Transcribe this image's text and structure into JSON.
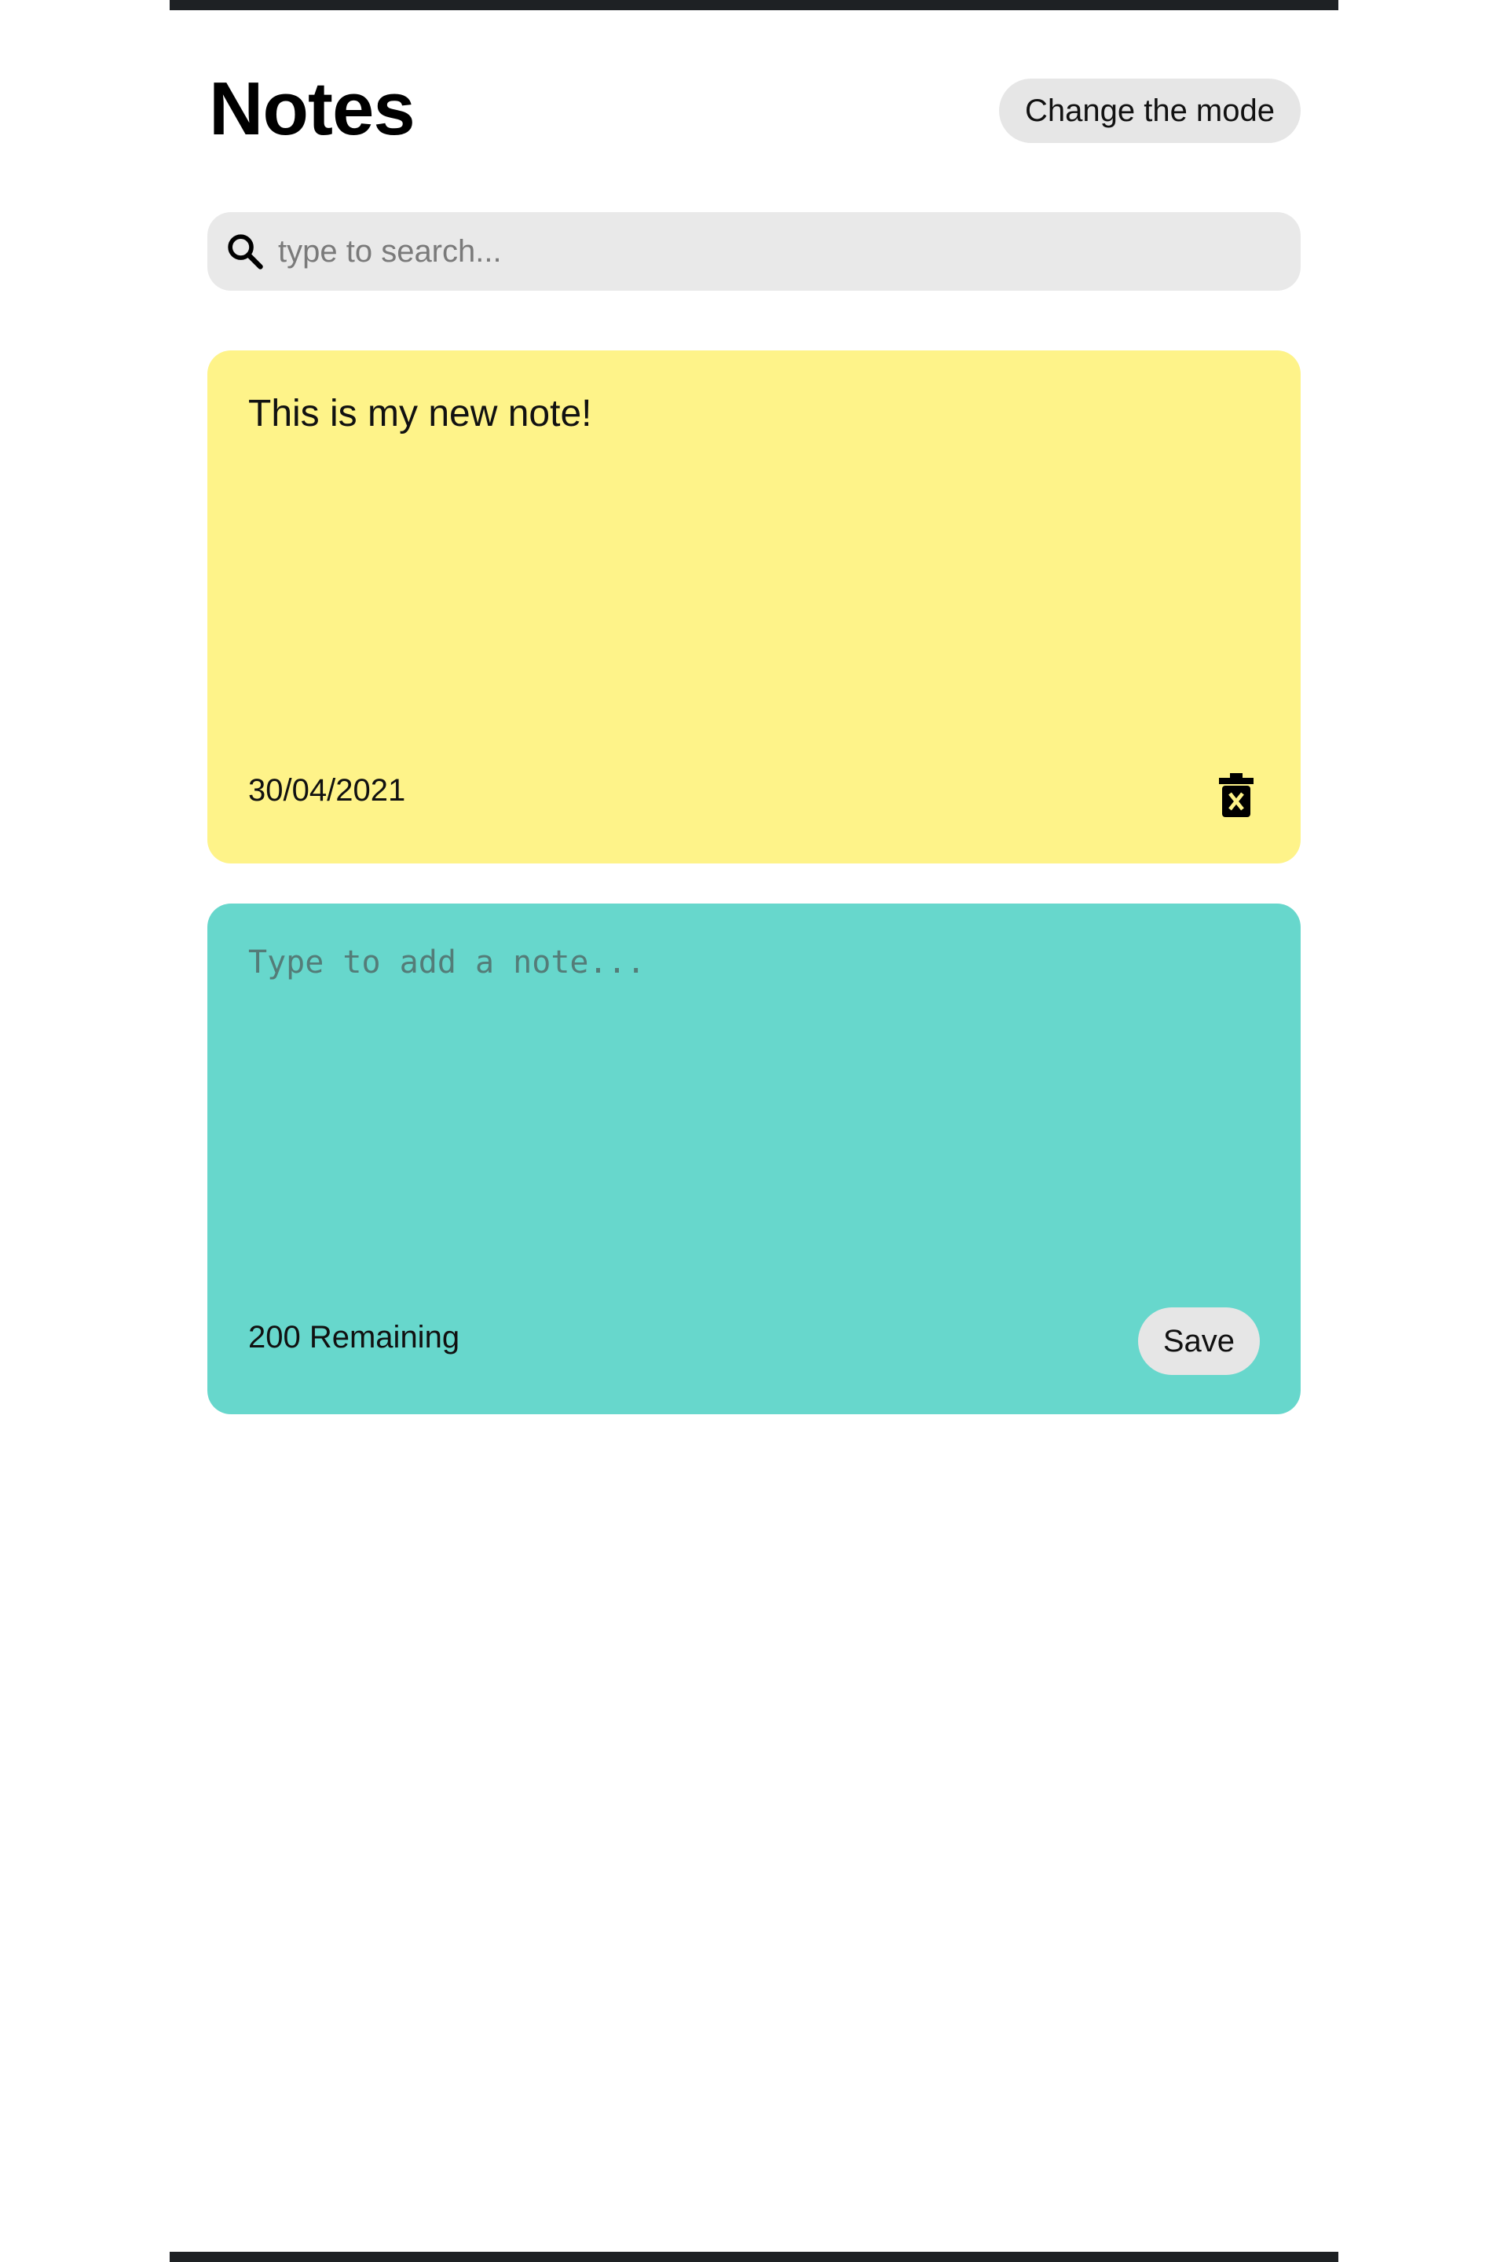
{
  "header": {
    "title": "Notes",
    "mode_button_label": "Change the mode"
  },
  "search": {
    "icon": "search-icon",
    "placeholder": "type to search..."
  },
  "notes": [
    {
      "text": "This is my new note!",
      "date": "30/04/2021",
      "delete_icon": "trash-icon",
      "color": "#fef389"
    }
  ],
  "add_note": {
    "placeholder": "Type to add a note...",
    "remaining": "200 Remaining",
    "save_label": "Save",
    "color": "#67d7cc"
  },
  "colors": {
    "frame_bar": "#1e2124",
    "button_bg": "#e6e6e6",
    "search_bg": "#e9e9e9"
  }
}
